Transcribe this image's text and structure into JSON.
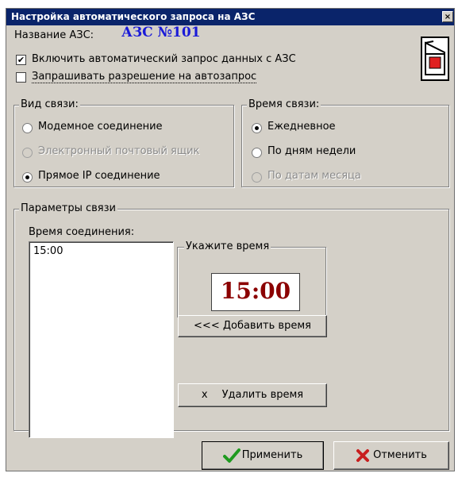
{
  "window": {
    "title": "Настройка автоматического запроса на АЗС",
    "close": "×"
  },
  "station": {
    "label": "Название АЗС:",
    "value": "АЗС №101"
  },
  "options": {
    "auto_request": {
      "label": "Включить автоматический запрос данных с АЗС",
      "checked": true,
      "mark": "✔"
    },
    "ask_permission": {
      "label": "Запрашивать разрешение на автозапрос",
      "checked": false,
      "mark": ""
    }
  },
  "connection_type": {
    "title": "Вид связи:",
    "items": [
      {
        "label": "Модемное соединение",
        "selected": false,
        "enabled": true
      },
      {
        "label": "Электронный почтовый ящик",
        "selected": false,
        "enabled": false
      },
      {
        "label": "Прямое IP соединение",
        "selected": true,
        "enabled": true
      }
    ]
  },
  "connection_time": {
    "title": "Время связи:",
    "items": [
      {
        "label": "Ежедневное",
        "selected": true,
        "enabled": true
      },
      {
        "label": "По дням недели",
        "selected": false,
        "enabled": true
      },
      {
        "label": "По датам месяца",
        "selected": false,
        "enabled": false
      }
    ]
  },
  "params": {
    "title": "Параметры связи",
    "list_label": "Время соединения:",
    "times": [
      "15:00"
    ],
    "time_group_title": "Укажите время",
    "time_value": "15:00",
    "add_label": "<<< Добавить время",
    "delete_icon": "x",
    "delete_label": "Удалить время"
  },
  "footer": {
    "apply_label": "Применить",
    "cancel_label": "Отменить",
    "colors": {
      "apply_icon": "#1f9a1f",
      "cancel_icon": "#c81e1e"
    }
  },
  "colors": {
    "titlebar": "#0a246a",
    "station": "#1a1ad8",
    "time": "#8b0000",
    "switch_red": "#e02020"
  }
}
